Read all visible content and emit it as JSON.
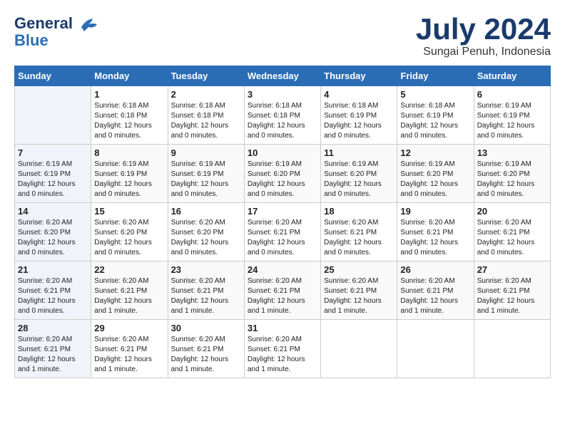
{
  "logo": {
    "line1": "General",
    "line2": "Blue"
  },
  "title": "July 2024",
  "subtitle": "Sungai Penuh, Indonesia",
  "days_header": [
    "Sunday",
    "Monday",
    "Tuesday",
    "Wednesday",
    "Thursday",
    "Friday",
    "Saturday"
  ],
  "weeks": [
    [
      {
        "num": "",
        "sunrise": "",
        "sunset": "",
        "daylight": ""
      },
      {
        "num": "1",
        "sunrise": "Sunrise: 6:18 AM",
        "sunset": "Sunset: 6:18 PM",
        "daylight": "Daylight: 12 hours and 0 minutes."
      },
      {
        "num": "2",
        "sunrise": "Sunrise: 6:18 AM",
        "sunset": "Sunset: 6:18 PM",
        "daylight": "Daylight: 12 hours and 0 minutes."
      },
      {
        "num": "3",
        "sunrise": "Sunrise: 6:18 AM",
        "sunset": "Sunset: 6:18 PM",
        "daylight": "Daylight: 12 hours and 0 minutes."
      },
      {
        "num": "4",
        "sunrise": "Sunrise: 6:18 AM",
        "sunset": "Sunset: 6:19 PM",
        "daylight": "Daylight: 12 hours and 0 minutes."
      },
      {
        "num": "5",
        "sunrise": "Sunrise: 6:18 AM",
        "sunset": "Sunset: 6:19 PM",
        "daylight": "Daylight: 12 hours and 0 minutes."
      },
      {
        "num": "6",
        "sunrise": "Sunrise: 6:19 AM",
        "sunset": "Sunset: 6:19 PM",
        "daylight": "Daylight: 12 hours and 0 minutes."
      }
    ],
    [
      {
        "num": "7",
        "sunrise": "Sunrise: 6:19 AM",
        "sunset": "Sunset: 6:19 PM",
        "daylight": "Daylight: 12 hours and 0 minutes."
      },
      {
        "num": "8",
        "sunrise": "Sunrise: 6:19 AM",
        "sunset": "Sunset: 6:19 PM",
        "daylight": "Daylight: 12 hours and 0 minutes."
      },
      {
        "num": "9",
        "sunrise": "Sunrise: 6:19 AM",
        "sunset": "Sunset: 6:19 PM",
        "daylight": "Daylight: 12 hours and 0 minutes."
      },
      {
        "num": "10",
        "sunrise": "Sunrise: 6:19 AM",
        "sunset": "Sunset: 6:20 PM",
        "daylight": "Daylight: 12 hours and 0 minutes."
      },
      {
        "num": "11",
        "sunrise": "Sunrise: 6:19 AM",
        "sunset": "Sunset: 6:20 PM",
        "daylight": "Daylight: 12 hours and 0 minutes."
      },
      {
        "num": "12",
        "sunrise": "Sunrise: 6:19 AM",
        "sunset": "Sunset: 6:20 PM",
        "daylight": "Daylight: 12 hours and 0 minutes."
      },
      {
        "num": "13",
        "sunrise": "Sunrise: 6:19 AM",
        "sunset": "Sunset: 6:20 PM",
        "daylight": "Daylight: 12 hours and 0 minutes."
      }
    ],
    [
      {
        "num": "14",
        "sunrise": "Sunrise: 6:20 AM",
        "sunset": "Sunset: 6:20 PM",
        "daylight": "Daylight: 12 hours and 0 minutes."
      },
      {
        "num": "15",
        "sunrise": "Sunrise: 6:20 AM",
        "sunset": "Sunset: 6:20 PM",
        "daylight": "Daylight: 12 hours and 0 minutes."
      },
      {
        "num": "16",
        "sunrise": "Sunrise: 6:20 AM",
        "sunset": "Sunset: 6:20 PM",
        "daylight": "Daylight: 12 hours and 0 minutes."
      },
      {
        "num": "17",
        "sunrise": "Sunrise: 6:20 AM",
        "sunset": "Sunset: 6:21 PM",
        "daylight": "Daylight: 12 hours and 0 minutes."
      },
      {
        "num": "18",
        "sunrise": "Sunrise: 6:20 AM",
        "sunset": "Sunset: 6:21 PM",
        "daylight": "Daylight: 12 hours and 0 minutes."
      },
      {
        "num": "19",
        "sunrise": "Sunrise: 6:20 AM",
        "sunset": "Sunset: 6:21 PM",
        "daylight": "Daylight: 12 hours and 0 minutes."
      },
      {
        "num": "20",
        "sunrise": "Sunrise: 6:20 AM",
        "sunset": "Sunset: 6:21 PM",
        "daylight": "Daylight: 12 hours and 0 minutes."
      }
    ],
    [
      {
        "num": "21",
        "sunrise": "Sunrise: 6:20 AM",
        "sunset": "Sunset: 6:21 PM",
        "daylight": "Daylight: 12 hours and 0 minutes."
      },
      {
        "num": "22",
        "sunrise": "Sunrise: 6:20 AM",
        "sunset": "Sunset: 6:21 PM",
        "daylight": "Daylight: 12 hours and 1 minute."
      },
      {
        "num": "23",
        "sunrise": "Sunrise: 6:20 AM",
        "sunset": "Sunset: 6:21 PM",
        "daylight": "Daylight: 12 hours and 1 minute."
      },
      {
        "num": "24",
        "sunrise": "Sunrise: 6:20 AM",
        "sunset": "Sunset: 6:21 PM",
        "daylight": "Daylight: 12 hours and 1 minute."
      },
      {
        "num": "25",
        "sunrise": "Sunrise: 6:20 AM",
        "sunset": "Sunset: 6:21 PM",
        "daylight": "Daylight: 12 hours and 1 minute."
      },
      {
        "num": "26",
        "sunrise": "Sunrise: 6:20 AM",
        "sunset": "Sunset: 6:21 PM",
        "daylight": "Daylight: 12 hours and 1 minute."
      },
      {
        "num": "27",
        "sunrise": "Sunrise: 6:20 AM",
        "sunset": "Sunset: 6:21 PM",
        "daylight": "Daylight: 12 hours and 1 minute."
      }
    ],
    [
      {
        "num": "28",
        "sunrise": "Sunrise: 6:20 AM",
        "sunset": "Sunset: 6:21 PM",
        "daylight": "Daylight: 12 hours and 1 minute."
      },
      {
        "num": "29",
        "sunrise": "Sunrise: 6:20 AM",
        "sunset": "Sunset: 6:21 PM",
        "daylight": "Daylight: 12 hours and 1 minute."
      },
      {
        "num": "30",
        "sunrise": "Sunrise: 6:20 AM",
        "sunset": "Sunset: 6:21 PM",
        "daylight": "Daylight: 12 hours and 1 minute."
      },
      {
        "num": "31",
        "sunrise": "Sunrise: 6:20 AM",
        "sunset": "Sunset: 6:21 PM",
        "daylight": "Daylight: 12 hours and 1 minute."
      },
      {
        "num": "",
        "sunrise": "",
        "sunset": "",
        "daylight": ""
      },
      {
        "num": "",
        "sunrise": "",
        "sunset": "",
        "daylight": ""
      },
      {
        "num": "",
        "sunrise": "",
        "sunset": "",
        "daylight": ""
      }
    ]
  ]
}
